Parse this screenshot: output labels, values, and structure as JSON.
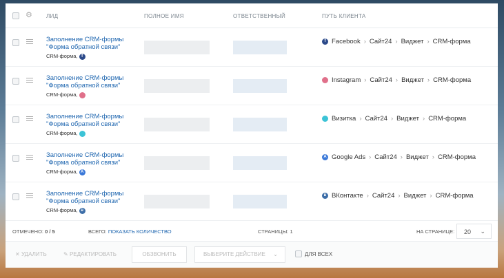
{
  "header": {
    "lead": "ЛИД",
    "full_name": "ПОЛНОЕ ИМЯ",
    "responsible": "ОТВЕТСТВЕННЫЙ",
    "path": "ПУТЬ КЛИЕНТА"
  },
  "rows": [
    {
      "title1": "Заполнение CRM-формы",
      "title2": "\"Форма обратной связи\"",
      "source": "CRM-форма,",
      "channel": "Facebook",
      "icon": "f",
      "color": "#2c4a8a",
      "path": [
        "Сайт24",
        "Виджет",
        "CRM-форма"
      ]
    },
    {
      "title1": "Заполнение CRM-формы",
      "title2": "\"Форма обратной связи\"",
      "source": "CRM-форма,",
      "channel": "Instagram",
      "icon": "",
      "color": "#e0708a",
      "path": [
        "Сайт24",
        "Виджет",
        "CRM-форма"
      ]
    },
    {
      "title1": "Заполнение CRM-формы",
      "title2": "\"Форма обратной связи\"",
      "source": "CRM-форма,",
      "channel": "Визитка",
      "icon": "",
      "color": "#3cc3d6",
      "path": [
        "Сайт24",
        "Виджет",
        "CRM-форма"
      ]
    },
    {
      "title1": "Заполнение CRM-формы",
      "title2": "\"Форма обратной связи\"",
      "source": "CRM-форма,",
      "channel": "Google Ads",
      "icon": "A",
      "color": "#3a78d8",
      "path": [
        "Сайт24",
        "Виджет",
        "CRM-форма"
      ]
    },
    {
      "title1": "Заполнение CRM-формы",
      "title2": "\"Форма обратной связи\"",
      "source": "CRM-форма,",
      "channel": "ВКонтакте",
      "icon": "в",
      "color": "#3d6ea8",
      "path": [
        "Сайт24",
        "Виджет",
        "CRM-форма"
      ]
    }
  ],
  "footer": {
    "checked_label": "ОТМЕЧЕНО:",
    "checked_value": "0 / 5",
    "total_label": "ВСЕГО:",
    "total_link": "ПОКАЗАТЬ КОЛИЧЕСТВО",
    "pages_label": "СТРАНИЦЫ:",
    "pages_value": "1",
    "per_page_label": "НА СТРАНИЦЕ:",
    "per_page_value": "20"
  },
  "actions": {
    "delete": "УДАЛИТЬ",
    "edit": "РЕДАКТИРОВАТЬ",
    "call": "ОБЗВОНИТЬ",
    "choose": "ВЫБЕРИТЕ ДЕЙСТВИЕ",
    "for_all": "ДЛЯ ВСЕХ"
  }
}
